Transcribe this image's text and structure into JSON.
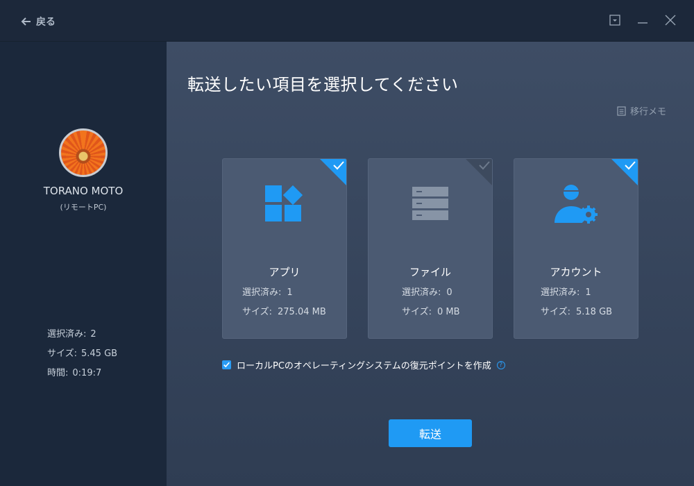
{
  "titlebar": {
    "back_label": "戻る"
  },
  "sidebar": {
    "pc_name": "TORANO MOTO",
    "pc_sub": "(リモートPC)",
    "stats": [
      {
        "label": "選択済み:",
        "value": "2"
      },
      {
        "label": "サイズ:",
        "value": "5.45 GB"
      },
      {
        "label": "時間:",
        "value": "0:19:7"
      }
    ]
  },
  "main": {
    "title": "転送したい項目を選択してください",
    "memo_label": "移行メモ",
    "cards": [
      {
        "label": "アプリ",
        "selected_label": "選択済み:",
        "selected_value": "1",
        "size_label": "サイズ:",
        "size_value": "275.04 MB",
        "checked": true
      },
      {
        "label": "ファイル",
        "selected_label": "選択済み:",
        "selected_value": "0",
        "size_label": "サイズ:",
        "size_value": "0 MB",
        "checked": false
      },
      {
        "label": "アカウント",
        "selected_label": "選択済み:",
        "selected_value": "1",
        "size_label": "サイズ:",
        "size_value": "5.18 GB",
        "checked": true
      }
    ],
    "restore_label": "ローカルPCのオペレーティングシステムの復元ポイントを作成",
    "help_glyph": "?",
    "transfer_label": "転送"
  },
  "colors": {
    "accent": "#1f9af4",
    "sidebar_bg": "#1b283b",
    "card_bg": "#4b5a72"
  },
  "icons": [
    "arrow-left-icon",
    "dropdown-icon",
    "minimize-icon",
    "close-icon",
    "memo-icon",
    "apps-icon",
    "files-icon",
    "account-icon",
    "check-icon"
  ]
}
